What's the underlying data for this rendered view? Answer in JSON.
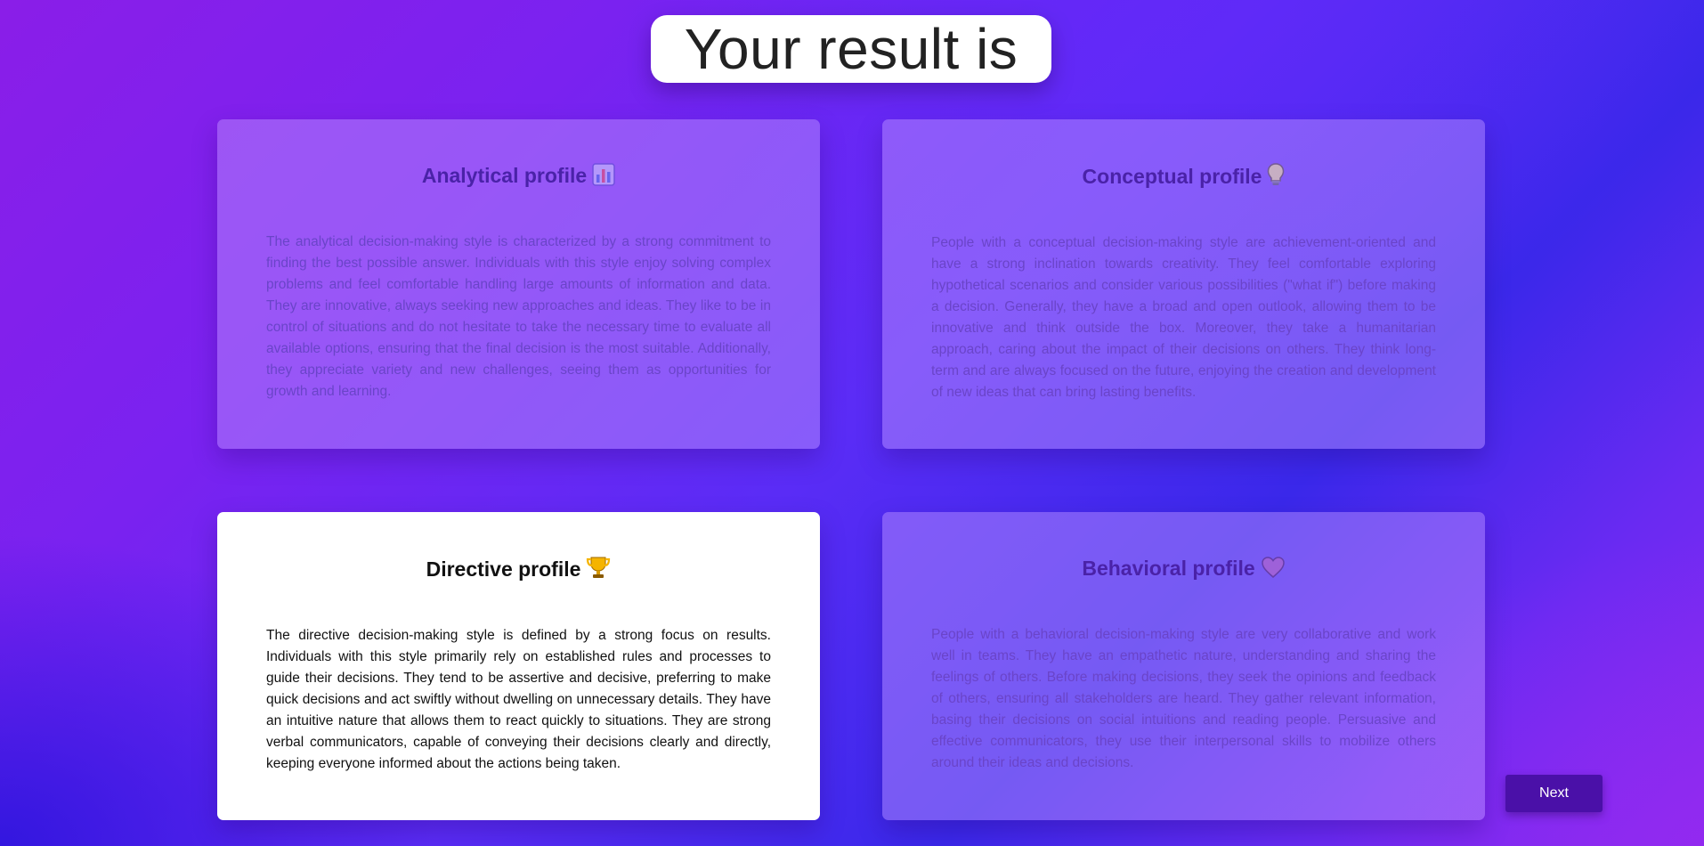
{
  "header": {
    "title": "Your result is"
  },
  "cards": [
    {
      "title": "Analytical profile",
      "icon": "bar-chart-icon",
      "state": "faded",
      "description": "The analytical decision-making style is characterized by a strong commitment to finding the best possible answer. Individuals with this style enjoy solving complex problems and feel comfortable handling large amounts of information and data. They are innovative, always seeking new approaches and ideas. They like to be in control of situations and do not hesitate to take the necessary time to evaluate all available options, ensuring that the final decision is the most suitable. Additionally, they appreciate variety and new challenges, seeing them as opportunities for growth and learning."
    },
    {
      "title": "Conceptual profile",
      "icon": "light-bulb-icon",
      "state": "faded",
      "description": "People with a conceptual decision-making style are achievement-oriented and have a strong inclination towards creativity. They feel comfortable exploring hypothetical scenarios and consider various possibilities (\"what if\") before making a decision. Generally, they have a broad and open outlook, allowing them to be innovative and think outside the box. Moreover, they take a humanitarian approach, caring about the impact of their decisions on others. They think long-term and are always focused on the future, enjoying the creation and development of new ideas that can bring lasting benefits."
    },
    {
      "title": "Directive profile",
      "icon": "trophy-icon",
      "state": "active",
      "description": "The directive decision-making style is defined by a strong focus on results. Individuals with this style primarily rely on established rules and processes to guide their decisions. They tend to be assertive and decisive, preferring to make quick decisions and act swiftly without dwelling on unnecessary details. They have an intuitive nature that allows them to react quickly to situations. They are strong verbal communicators, capable of conveying their decisions clearly and directly, keeping everyone informed about the actions being taken."
    },
    {
      "title": "Behavioral profile",
      "icon": "heart-icon",
      "state": "faded",
      "description": "People with a behavioral decision-making style are very collaborative and work well in teams. They have an empathetic nature, understanding and sharing the feelings of others. Before making decisions, they seek the opinions and feedback of others, ensuring all stakeholders are heard. They gather relevant information, basing their decisions on social intuitions and reading people. Persuasive and effective communicators, they use their interpersonal skills to mobilize others around their ideas and decisions."
    }
  ],
  "footer": {
    "next_label": "Next"
  },
  "colors": {
    "accent": "#4a10a8",
    "faded_title": "#4a22a8",
    "faded_text": "#6a44c8"
  }
}
